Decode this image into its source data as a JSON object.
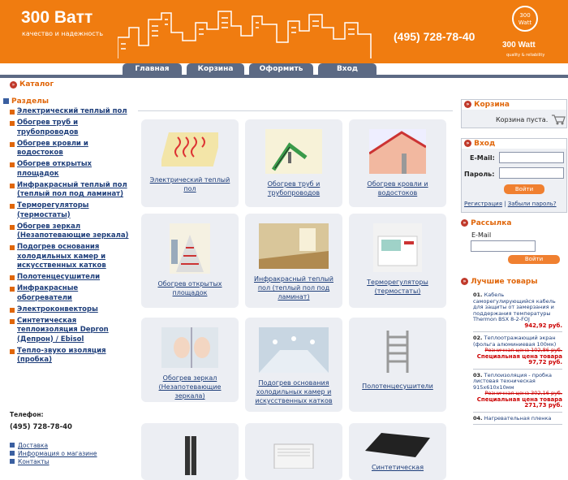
{
  "header": {
    "logo": "300 Ватт",
    "slogan": "качество и надежность",
    "phone": "(495) 728-78-40",
    "badge": "300 Watt",
    "brand": "300 Watt",
    "brand_sub": "quality & reliability"
  },
  "nav": [
    "Главная",
    "Корзина",
    "Оформить",
    "Вход"
  ],
  "catalog_title": "Каталог",
  "sections_title": "Разделы",
  "menu": [
    "Электрический теплый пол",
    "Обогрев труб и трубопроводов",
    "Обогрев кровли и водостоков",
    "Обогрев открытых площадок",
    "Инфракрасный теплый пол (теплый пол под ламинат)",
    "Терморегуляторы (термостаты)",
    "Обогрев зеркал (Незапотевающие зеркала)",
    "Подогрев основания холодильных камер и искусственных катков",
    "Полотенцесушители",
    "Инфракрасные обогреватели",
    "Электроконвекторы",
    "Синтетическая теплоизоляция Depron (Депрон) / Ebisol",
    "Тепло-звуко изоляция (пробка)"
  ],
  "contact": {
    "label": "Телефон:",
    "phone": "(495) 728-78-40",
    "links": [
      "Доставка",
      "Информация о магазине",
      "Контакты"
    ]
  },
  "cards": [
    "Электрический теплый пол",
    "Обогрев труб и трубопроводов",
    "Обогрев кровли и водостоков",
    "Обогрев открытых площадок",
    "Инфракрасный теплый пол (теплый пол под ламинат)",
    "Терморегуляторы (термостаты)",
    "Обогрев зеркал (Незапотевающие зеркала)",
    "Подогрев основания холодильных камер и искусственных катков",
    "Полотенцесушители",
    "",
    "",
    "Синтетическая"
  ],
  "cart": {
    "title": "Корзина",
    "empty": "Корзина пуста."
  },
  "login": {
    "title": "Вход",
    "email_label": "E-Mail:",
    "password_label": "Пароль:",
    "button": "Войти",
    "register": "Регистрация",
    "forgot": "Забыли пароль?",
    "separator": "|"
  },
  "newsletter": {
    "title": "Рассылка",
    "email_label": "E-Mail",
    "button": "Войти"
  },
  "best": {
    "title": "Лучшие товары",
    "items": [
      {
        "num": "01.",
        "name": "Кабель саморегулирующийся кабель для защиты от замерзания и поддержания температуры Thermon BSX 8-2-FOJ",
        "price": "942,92 руб.",
        "old": "",
        "special": ""
      },
      {
        "num": "02.",
        "name": "Теплоотражающий экран (фольга алюминиевая 100мк)",
        "price": "",
        "old": "Розничная цена 102,86 руб.",
        "special": "Специальная цена товара 97,72 руб."
      },
      {
        "num": "03.",
        "name": "Теплоизоляция - пробка листовая техническая 915х610х10мм",
        "price": "",
        "old": "Розничная цена 302,16 руб.",
        "special": "Специальная цена товара 271,73 руб."
      },
      {
        "num": "04.",
        "name": "Нагревательная пленка",
        "price": "",
        "old": "",
        "special": ""
      }
    ]
  }
}
